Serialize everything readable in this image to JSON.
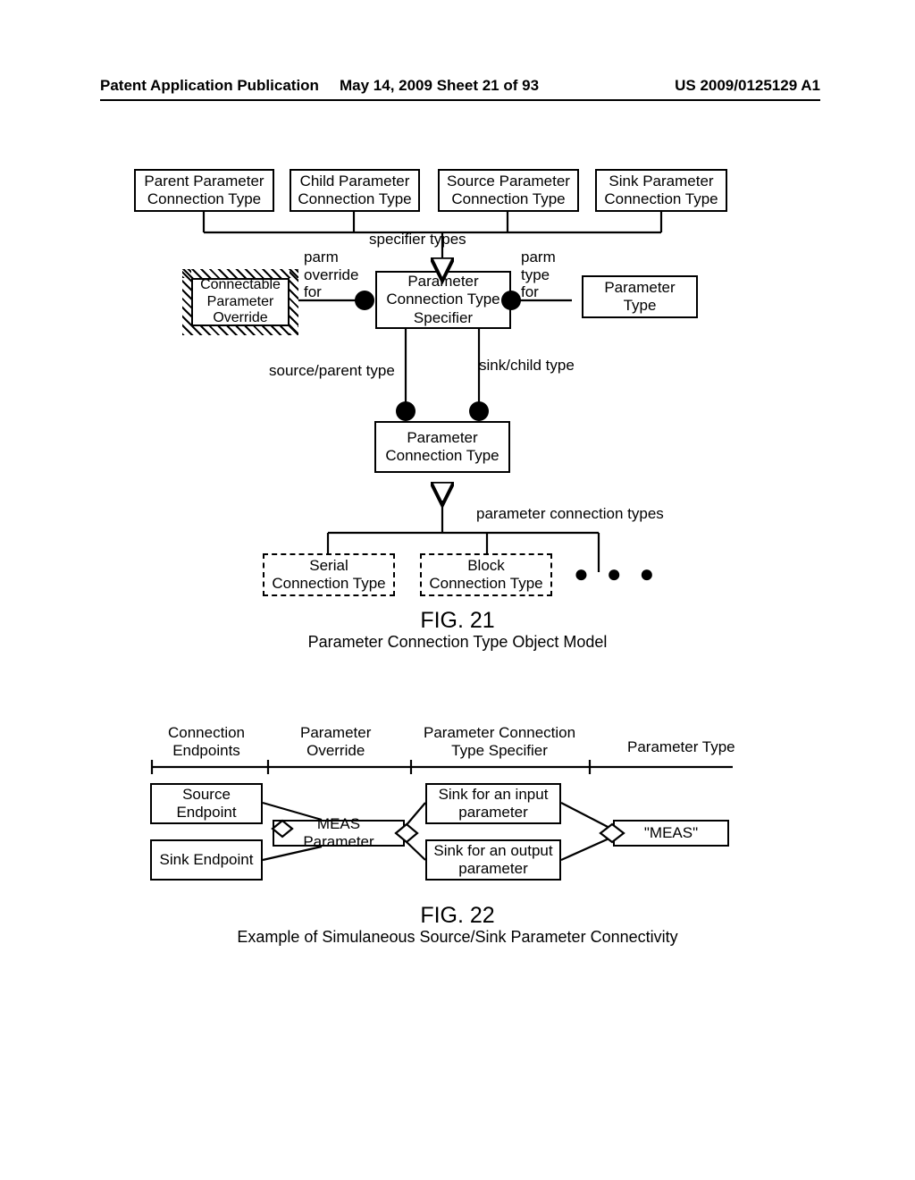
{
  "header": {
    "left": "Patent Application Publication",
    "mid": "May 14, 2009  Sheet 21 of 93",
    "right": "US 2009/0125129 A1"
  },
  "fig21": {
    "num": "FIG. 21",
    "caption": "Parameter Connection Type Object Model",
    "boxes": {
      "parent": "Parent Parameter\nConnection Type",
      "child": "Child Parameter\nConnection Type",
      "source": "Source Parameter\nConnection Type",
      "sink": "Sink Parameter\nConnection Type",
      "override": "Connectable\nParameter\nOverride",
      "specifier": "Parameter\nConnection Type\nSpecifier",
      "ptype": "Parameter\nType",
      "pconn": "Parameter\nConnection Type",
      "serial": "Serial\nConnection Type",
      "block": "Block\nConnection Type"
    },
    "labels": {
      "specifier_types": "specifier types",
      "parm_override_for": "parm\noverride\nfor",
      "parm_type_for": "parm\ntype\nfor",
      "source_parent": "source/parent type",
      "sink_child": "sink/child type",
      "conn_types": "parameter connection types",
      "dots": "● ● ●"
    }
  },
  "fig22": {
    "num": "FIG. 22",
    "caption": "Example of Simulaneous Source/Sink Parameter Connectivity",
    "headers": {
      "endpoints": "Connection\nEndpoints",
      "override": "Parameter\nOverride",
      "specifier": "Parameter Connection\nType Specifier",
      "ptype": "Parameter Type"
    },
    "boxes": {
      "src": "Source\nEndpoint",
      "sink": "Sink\nEndpoint",
      "meas": "MEAS Parameter",
      "sinkin": "Sink for an input\nparameter",
      "sinkout": "Sink for an output\nparameter",
      "meastype": "\"MEAS\""
    }
  }
}
